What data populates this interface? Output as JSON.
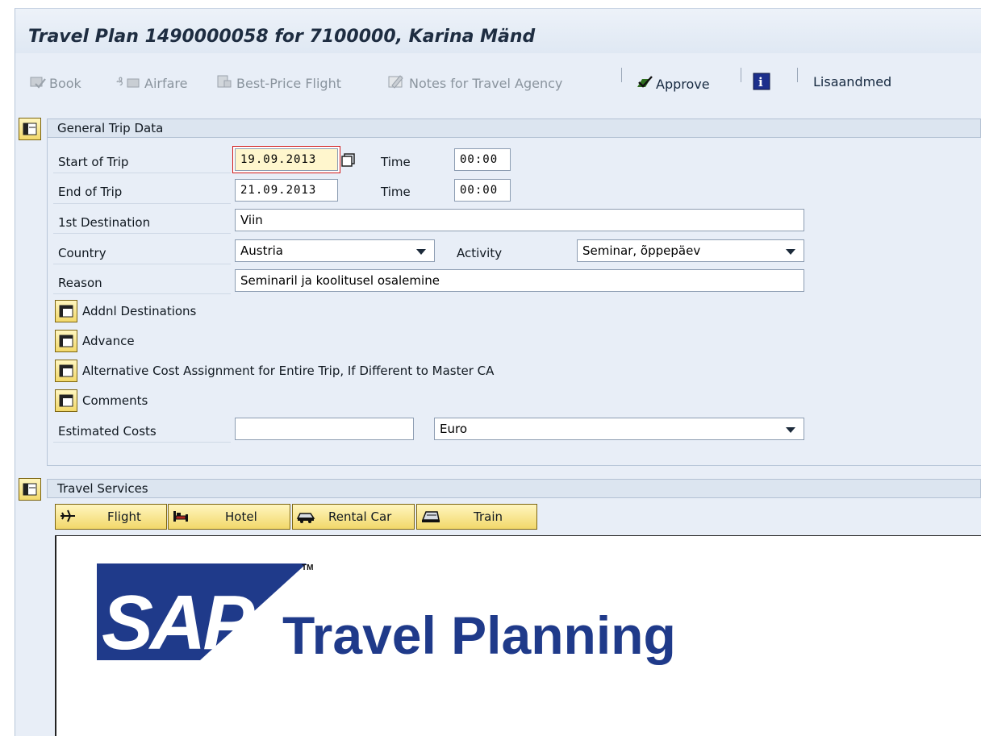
{
  "window": {
    "title": "Travel Plan 1490000058 for 7100000, Karina Mänd"
  },
  "toolbar": {
    "book": "Book",
    "airfare": "Airfare",
    "best_price": "Best-Price Flight",
    "notes": "Notes for Travel Agency",
    "approve": "Approve",
    "extra": "Lisaandmed"
  },
  "general": {
    "header": "General Trip Data",
    "start_label": "Start of Trip",
    "start_value": "19.09.2013",
    "time_label": "Time",
    "start_time": "00:00",
    "end_label": "End of Trip",
    "end_value": "21.09.2013",
    "end_time": "00:00",
    "dest_label": "1st Destination",
    "dest_value": "Viin",
    "country_label": "Country",
    "country_value": "Austria",
    "activity_label": "Activity",
    "activity_value": "Seminar, õppepäev",
    "reason_label": "Reason",
    "reason_value": "Seminaril ja koolitusel osalemine",
    "addnl_dest": "Addnl Destinations",
    "advance": "Advance",
    "alt_cost": "Alternative Cost Assignment for Entire Trip, If Different to Master CA",
    "comments": "Comments",
    "est_label": "Estimated Costs",
    "est_value": "",
    "currency_value": "Euro"
  },
  "services": {
    "header": "Travel Services",
    "flight": "Flight",
    "hotel": "Hotel",
    "rental": "Rental Car",
    "train": "Train"
  },
  "logo": {
    "brand": "SAP",
    "tm": "TM",
    "product": "Travel Planning"
  },
  "colors": {
    "accent": "#1f3a8a",
    "button": "#f2d86a",
    "background": "#e8eef7"
  }
}
